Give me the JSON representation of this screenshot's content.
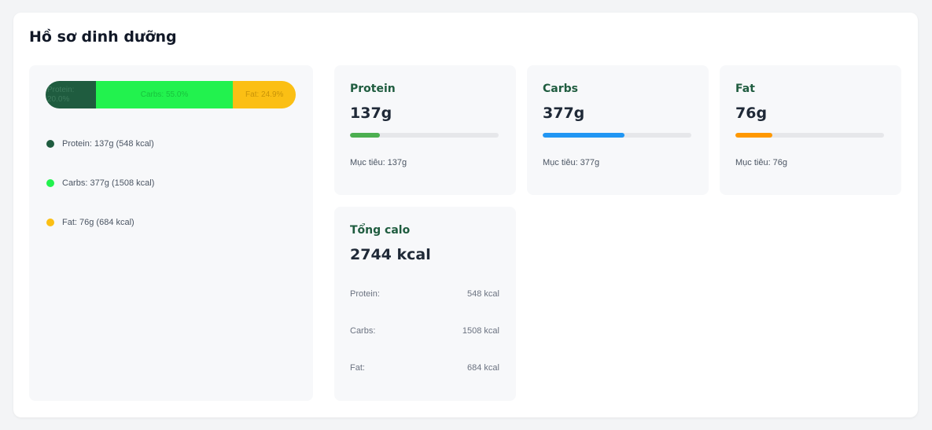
{
  "page": {
    "title": "Hồ sơ dinh dưỡng"
  },
  "distribution": {
    "segments": [
      {
        "label": "Protein: 20.0%",
        "percent": 20.0,
        "color": "#1f5c3f"
      },
      {
        "label": "Carbs: 55.0%",
        "percent": 55.0,
        "color": "#22f24e"
      },
      {
        "label": "Fat: 24.9%",
        "percent": 24.9,
        "color": "#fbbf14"
      }
    ],
    "legend": [
      {
        "label": "Protein: 137g (548 kcal)",
        "color": "#1f5c3f"
      },
      {
        "label": "Carbs: 377g (1508 kcal)",
        "color": "#22f24e"
      },
      {
        "label": "Fat: 76g (684 kcal)",
        "color": "#fbbf14"
      }
    ]
  },
  "macros": [
    {
      "name": "Protein",
      "value": "137g",
      "target": "Mục tiêu: 137g",
      "progress_percent": 20,
      "bar_color": "#4caf50"
    },
    {
      "name": "Carbs",
      "value": "377g",
      "target": "Mục tiêu: 377g",
      "progress_percent": 55,
      "bar_color": "#2196f3"
    },
    {
      "name": "Fat",
      "value": "76g",
      "target": "Mục tiêu: 76g",
      "progress_percent": 25,
      "bar_color": "#ff9800"
    }
  ],
  "calories": {
    "title": "Tổng calo",
    "total": "2744 kcal",
    "rows": [
      {
        "label": "Protein:",
        "value": "548 kcal"
      },
      {
        "label": "Carbs:",
        "value": "1508 kcal"
      },
      {
        "label": "Fat:",
        "value": "684 kcal"
      }
    ]
  }
}
